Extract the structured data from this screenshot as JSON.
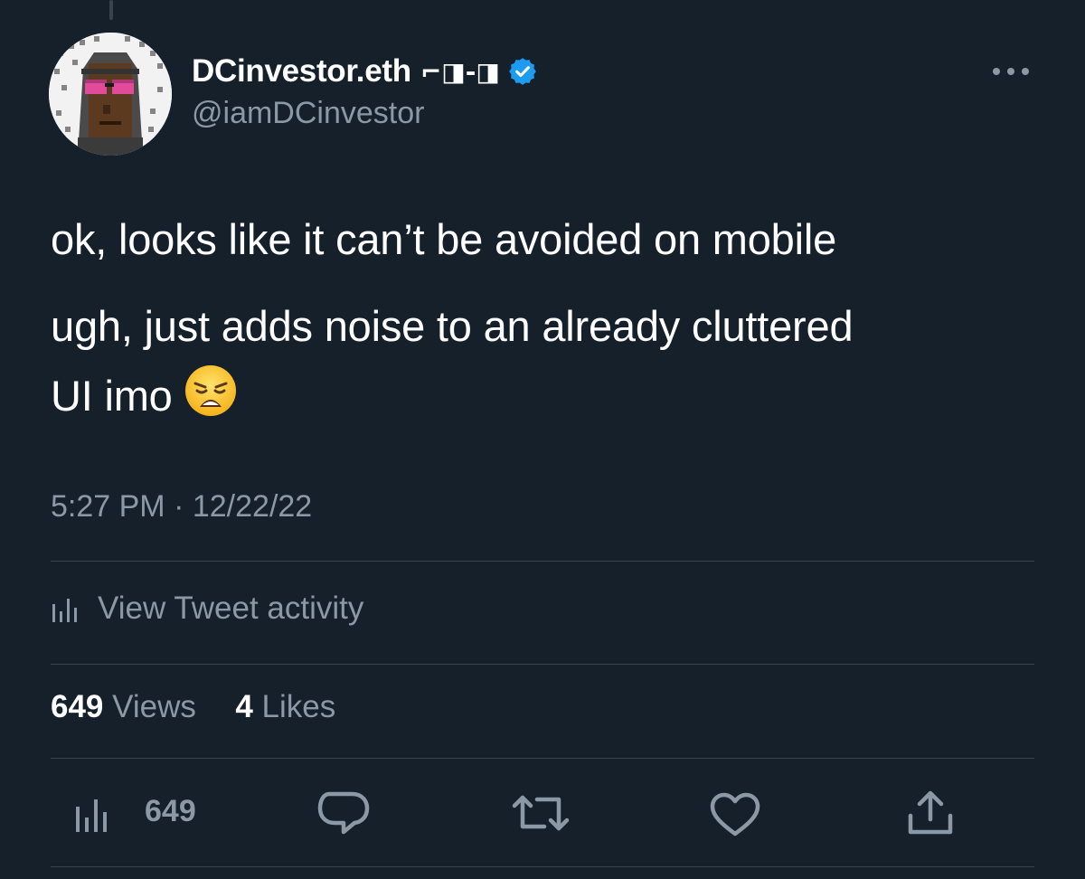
{
  "author": {
    "display_name": "DCinvestor.eth",
    "name_glyphs": "⌐◨-◨",
    "handle": "@iamDCinvestor",
    "verified": true
  },
  "tweet": {
    "line1": "ok, looks like it can’t be avoided on mobile",
    "line2": "ugh, just adds noise to an already cluttered",
    "line3": "UI imo",
    "emoji": "weary-face-emoji",
    "time": "5:27 PM",
    "separator": "·",
    "date": "12/22/22"
  },
  "activity": {
    "label": "View Tweet activity"
  },
  "stats": {
    "views_count": "649",
    "views_label": "Views",
    "likes_count": "4",
    "likes_label": "Likes"
  },
  "actions": {
    "views_count": "649",
    "icons": [
      "analytics-icon",
      "reply-icon",
      "retweet-icon",
      "like-icon",
      "share-icon"
    ]
  },
  "colors": {
    "background": "#15202b",
    "text": "#ffffff",
    "secondary": "#8b98a5",
    "divider": "#38444d",
    "verified": "#1d9bf0"
  }
}
